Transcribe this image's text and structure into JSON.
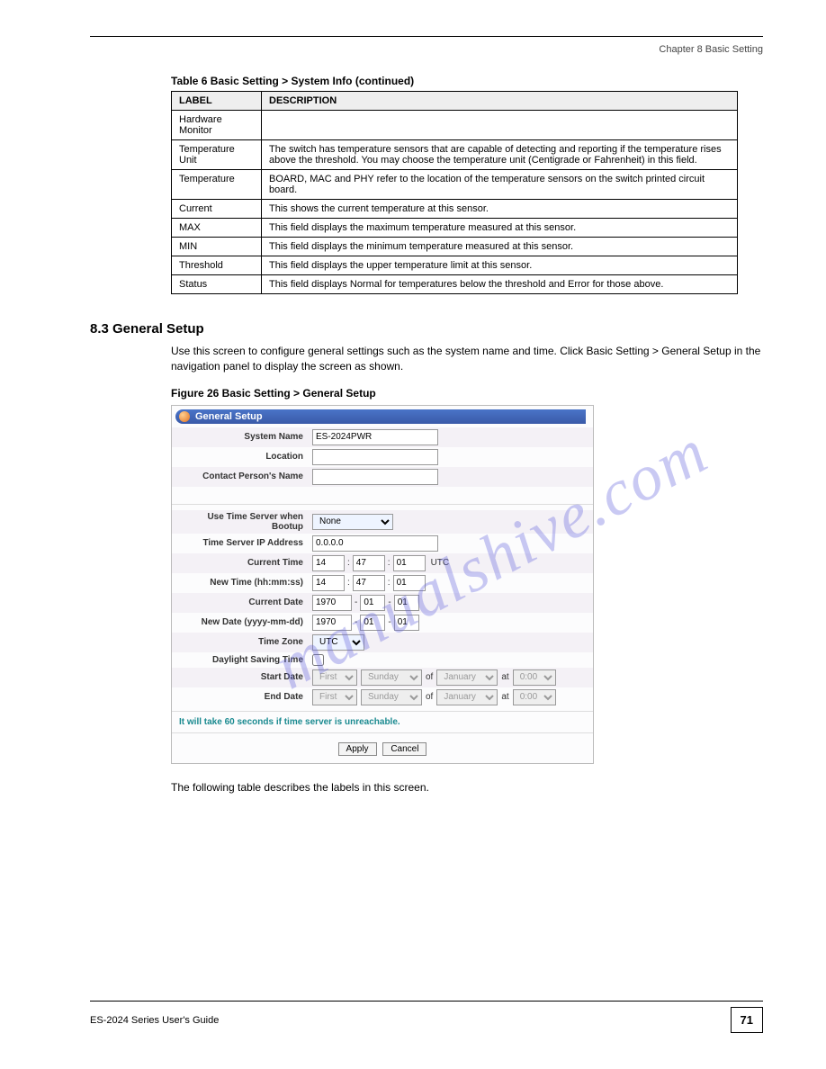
{
  "header": {
    "chapter": "Chapter 8 Basic Setting"
  },
  "table": {
    "caption": "Table 6   Basic Setting > System Info (continued)",
    "head": {
      "label": "LABEL",
      "desc": "DESCRIPTION"
    },
    "rows": [
      {
        "label": "Hardware Monitor",
        "desc": ""
      },
      {
        "label": "Temperature Unit",
        "desc": "The switch has temperature sensors that are capable of detecting and reporting if the temperature rises above the threshold. You may choose the temperature unit (Centigrade or Fahrenheit) in this field."
      },
      {
        "label": "Temperature",
        "desc": "BOARD, MAC and PHY refer to the location of the temperature sensors on the switch printed circuit board."
      },
      {
        "label": "Current",
        "desc": "This shows the current temperature at this sensor."
      },
      {
        "label": "MAX",
        "desc": "This field displays the maximum temperature measured at this sensor."
      },
      {
        "label": "MIN",
        "desc": "This field displays the minimum temperature measured at this sensor."
      },
      {
        "label": "Threshold",
        "desc": "This field displays the upper temperature limit at this sensor."
      },
      {
        "label": "Status",
        "desc": "This field displays Normal for temperatures below the threshold and Error for those above."
      }
    ]
  },
  "section": {
    "heading": "8.3  General Setup",
    "para1": "Use this screen to configure general settings such as the system name and time. Click Basic Setting > General Setup in the navigation panel to display the screen as shown.",
    "fig_caption": "Figure 26   Basic Setting > General Setup"
  },
  "gs": {
    "title": "General Setup",
    "labels": {
      "system_name": "System Name",
      "location": "Location",
      "contact": "Contact Person's Name",
      "use_time_server": "Use Time Server when Bootup",
      "time_server_ip": "Time Server IP Address",
      "current_time": "Current Time",
      "new_time": "New Time (hh:mm:ss)",
      "current_date": "Current Date",
      "new_date": "New Date (yyyy-mm-dd)",
      "time_zone": "Time Zone",
      "dst": "Daylight Saving Time",
      "start_date": "Start Date",
      "end_date": "End Date"
    },
    "values": {
      "system_name": "ES-2024PWR",
      "location": "",
      "contact": "",
      "use_time_server": "None",
      "time_server_ip": "0.0.0.0",
      "current_time_hh": "14",
      "current_time_mm": "47",
      "current_time_ss": "01",
      "utc_label": "UTC",
      "new_time_hh": "14",
      "new_time_mm": "47",
      "new_time_ss": "01",
      "current_date_y": "1970",
      "current_date_m": "01",
      "current_date_d": "01",
      "new_date_y": "1970",
      "new_date_m": "01",
      "new_date_d": "01",
      "time_zone": "UTC",
      "dst_checked": false,
      "date_ord": "First",
      "date_dow": "Sunday",
      "of_label": "of",
      "date_month": "January",
      "at_label": "at",
      "date_time": "0:00"
    },
    "note": "It will take 60 seconds if time server is unreachable.",
    "buttons": {
      "apply": "Apply",
      "cancel": "Cancel"
    }
  },
  "post_text": "The following table describes the labels in this screen.",
  "footer": {
    "guide": "ES-2024 Series User's Guide",
    "page": "71"
  }
}
